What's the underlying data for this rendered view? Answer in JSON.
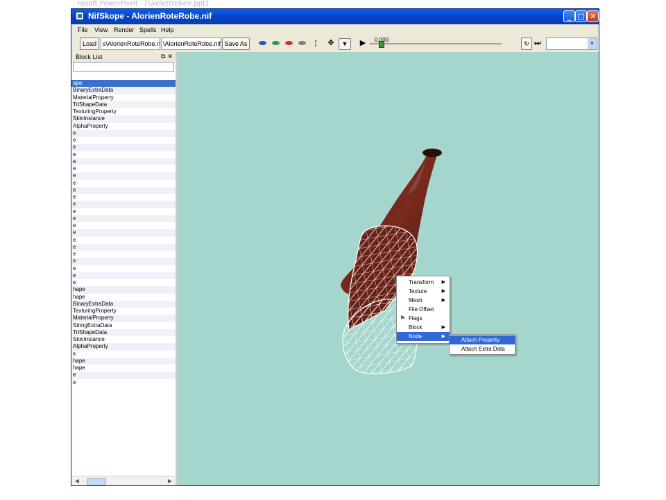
{
  "background_window": {
    "title": "rosoft PowerPoint - [Skelettroben.ppt]"
  },
  "window": {
    "title": "NifSkope - AlorienRoteRobe.nif",
    "controls": {
      "minimize": "_",
      "maximize": "□",
      "close": "✕"
    }
  },
  "menubar": {
    "items": [
      "File",
      "View",
      "Render",
      "Spells",
      "Help"
    ]
  },
  "toolbar": {
    "load_label": "Load",
    "load_path": "s\\AlorienRoteRobe.nif",
    "save_path": "\\AlorienRoteRobe.nif",
    "save_as_label": "Save As",
    "time_value": "0.000",
    "play_icon": "play-icon",
    "eye_colors": [
      "#2a58b8",
      "#2a9a4a",
      "#c83232",
      "#808080"
    ]
  },
  "block_list": {
    "title": "Block List",
    "rows": [
      "ape",
      "BinaryExtraData",
      "MaterialProperty",
      "TriShapeData",
      "TexturingProperty",
      "SkinInstance",
      "AlphaProperty",
      "e",
      "e",
      "e",
      "e",
      "e",
      "e",
      "e",
      "e",
      "e",
      "e",
      "e",
      "e",
      "e",
      "e",
      "e",
      "e",
      "e",
      "e",
      "e",
      "e",
      "e",
      "e",
      "hape",
      "hape",
      "BinaryExtraData",
      "TexturingProperty",
      "MaterialProperty",
      "StringExtraData",
      "TriShapeData",
      "SkinInstance",
      "AlphaProperty",
      "e",
      "hape",
      "hape",
      "e",
      "e"
    ],
    "selected_index": 0
  },
  "viewport": {
    "background": "#a5d6ce"
  },
  "context_menu": {
    "items": [
      {
        "label": "Transform",
        "submenu": true
      },
      {
        "label": "Texture",
        "submenu": true
      },
      {
        "label": "Mesh",
        "submenu": true
      },
      {
        "label": "File Offset",
        "submenu": false
      },
      {
        "label": "Flags",
        "submenu": false,
        "icon": "flag-icon"
      },
      {
        "label": "Block",
        "submenu": true
      },
      {
        "label": "Node",
        "submenu": true,
        "highlighted": true
      }
    ],
    "node_submenu": [
      {
        "label": "Attach Property",
        "highlighted": true
      },
      {
        "label": "Attach Extra Data",
        "highlighted": false
      }
    ]
  }
}
